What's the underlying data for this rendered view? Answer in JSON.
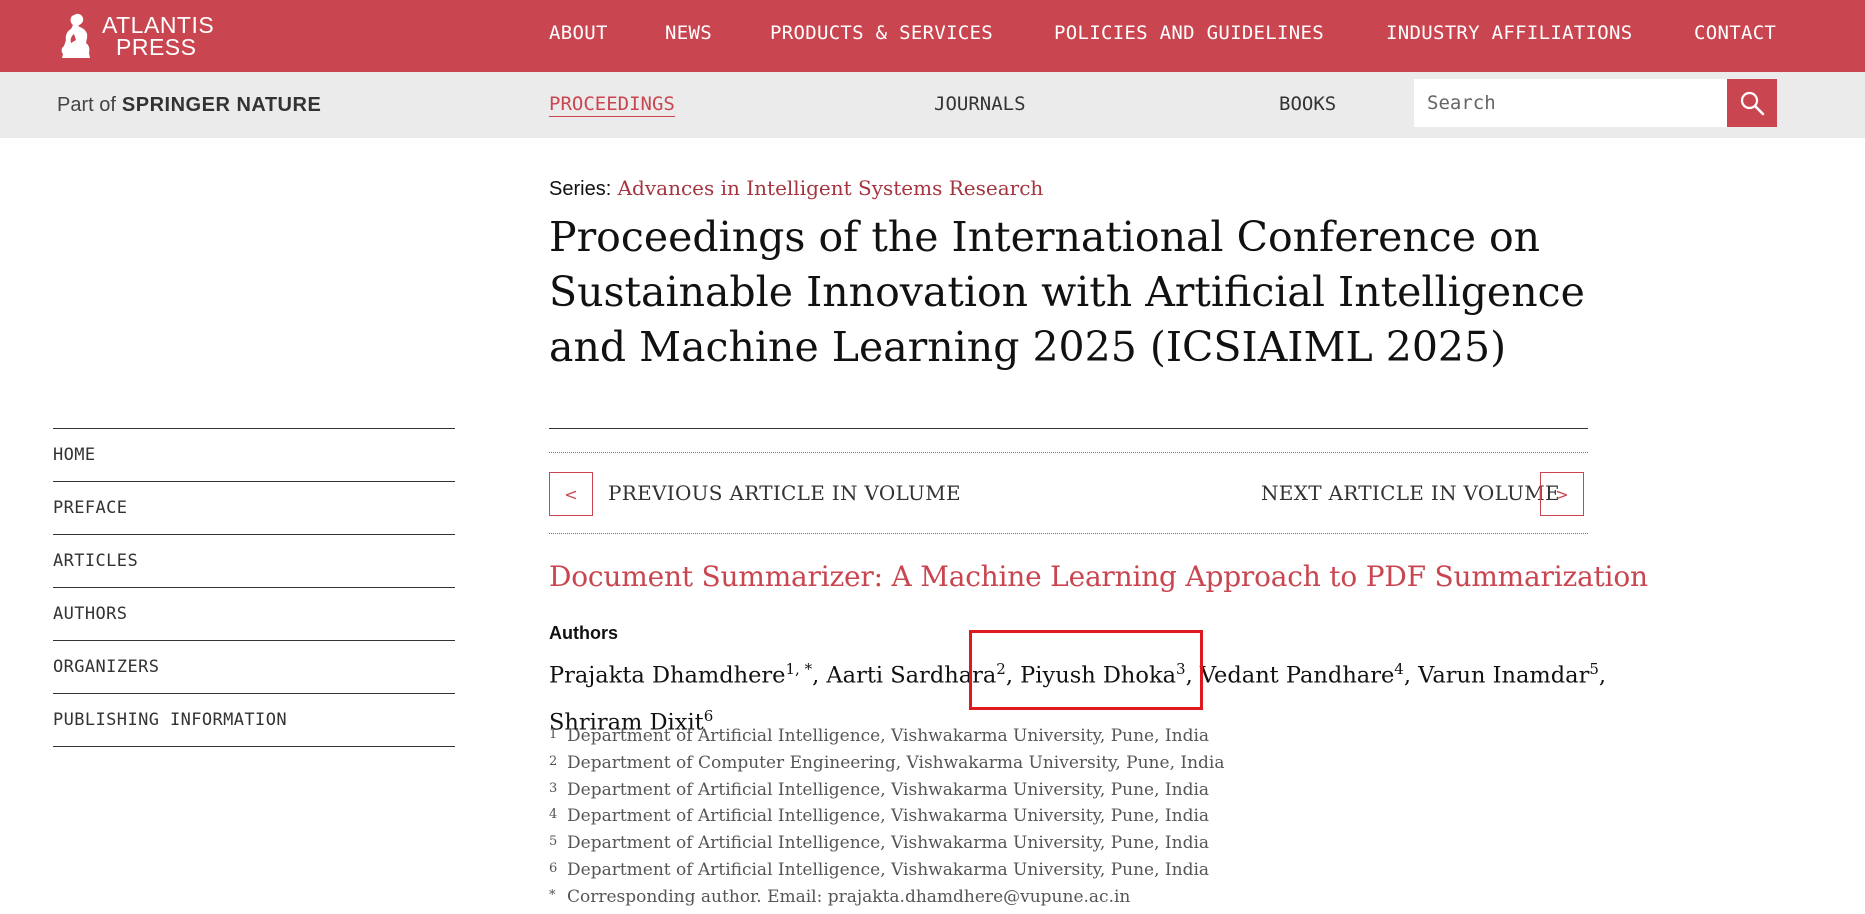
{
  "header": {
    "logo_line1": "ATLANTIS",
    "logo_line2": "PRESS",
    "nav": [
      "ABOUT",
      "NEWS",
      "PRODUCTS & SERVICES",
      "POLICIES AND GUIDELINES",
      "INDUSTRY AFFILIATIONS",
      "CONTACT"
    ]
  },
  "subheader": {
    "part_of": "Part of",
    "brand": "SPRINGER NATURE",
    "nav": [
      "PROCEEDINGS",
      "JOURNALS",
      "BOOKS"
    ],
    "active": "PROCEEDINGS",
    "search_placeholder": "Search"
  },
  "sidebar": {
    "items": [
      "HOME",
      "PREFACE",
      "ARTICLES",
      "AUTHORS",
      "ORGANIZERS",
      "PUBLISHING INFORMATION"
    ]
  },
  "main": {
    "series_label": "Series:",
    "series_name": "Advances in Intelligent Systems Research",
    "title": "Proceedings of the International Conference on Sustainable Innovation with Artificial Intelligence and Machine Learning 2025 (ICSIAIML 2025)",
    "prev_label": "PREVIOUS ARTICLE IN VOLUME",
    "next_label": "NEXT ARTICLE IN VOLUME",
    "prev_symbol": "<",
    "next_symbol": ">",
    "article_title": "Document Summarizer: A Machine Learning Approach to PDF Summarization",
    "authors_heading": "Authors",
    "authors": [
      {
        "name": "Prajakta Dhamdhere",
        "sup": "1, *"
      },
      {
        "name": "Aarti Sardhara",
        "sup": "2"
      },
      {
        "name": "Piyush Dhoka",
        "sup": "3"
      },
      {
        "name": "Vedant Pandhare",
        "sup": "4"
      },
      {
        "name": "Varun Inamdar",
        "sup": "5"
      },
      {
        "name": "Shriram Dixit",
        "sup": "6"
      }
    ],
    "affiliations": [
      {
        "num": "1",
        "text": "Department of Artificial Intelligence, Vishwakarma University, Pune, India"
      },
      {
        "num": "2",
        "text": "Department of Computer Engineering, Vishwakarma University, Pune, India"
      },
      {
        "num": "3",
        "text": "Department of Artificial Intelligence, Vishwakarma University, Pune, India"
      },
      {
        "num": "4",
        "text": "Department of Artificial Intelligence, Vishwakarma University, Pune, India"
      },
      {
        "num": "5",
        "text": "Department of Artificial Intelligence, Vishwakarma University, Pune, India"
      },
      {
        "num": "6",
        "text": "Department of Artificial Intelligence, Vishwakarma University, Pune, India"
      },
      {
        "num": "*",
        "text": "Corresponding author. Email: prajakta.dhamdhere@vupune.ac.in"
      }
    ]
  },
  "colors": {
    "brand": "#c94651",
    "highlight_box": "#e0191f"
  },
  "icons": {
    "logo": "thinker-statue-icon",
    "search": "search-icon"
  }
}
